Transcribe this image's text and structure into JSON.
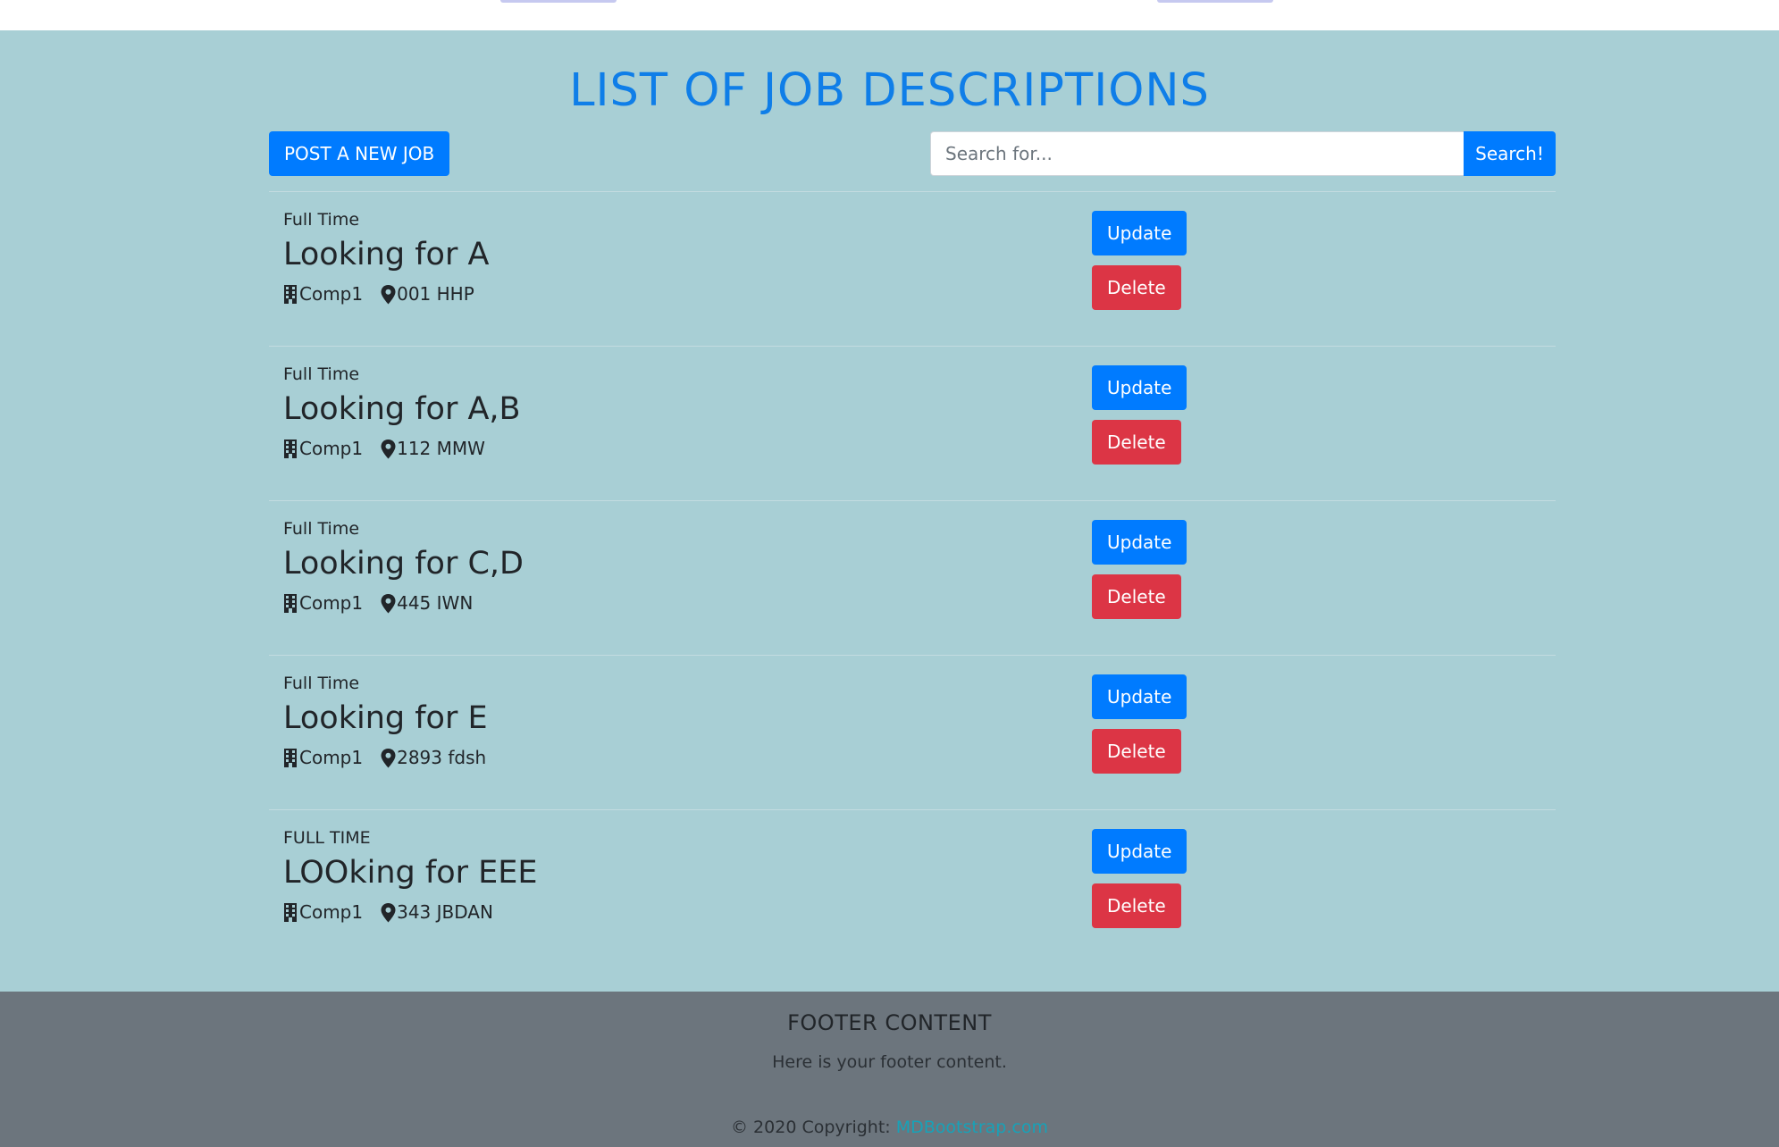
{
  "page": {
    "title": "LIST OF JOB DESCRIPTIONS"
  },
  "toolbar": {
    "post_button_label": "POST A NEW JOB",
    "search_placeholder": "Search for...",
    "search_value": "",
    "search_button_label": "Search!"
  },
  "jobs": [
    {
      "type": "Full Time",
      "title": "Looking for A",
      "company": "Comp1",
      "location": "001 HHP",
      "update_label": "Update",
      "delete_label": "Delete"
    },
    {
      "type": "Full Time",
      "title": "Looking for A,B",
      "company": "Comp1",
      "location": "112 MMW",
      "update_label": "Update",
      "delete_label": "Delete"
    },
    {
      "type": "Full Time",
      "title": "Looking for C,D",
      "company": "Comp1",
      "location": "445 IWN",
      "update_label": "Update",
      "delete_label": "Delete"
    },
    {
      "type": "Full Time",
      "title": "Looking for E",
      "company": "Comp1",
      "location": "2893 fdsh",
      "update_label": "Update",
      "delete_label": "Delete"
    },
    {
      "type": "FULL TIME",
      "title": "LOOking for EEE",
      "company": "Comp1",
      "location": "343 JBDAN",
      "update_label": "Update",
      "delete_label": "Delete"
    }
  ],
  "icons": {
    "company": "building-icon",
    "location": "map-marker-icon"
  },
  "footer": {
    "title": "FOOTER CONTENT",
    "text": "Here is your footer content.",
    "copyright_prefix": "© 2020 Copyright: ",
    "copyright_link": "MDBootstrap.com"
  },
  "colors": {
    "background": "#a8cfd5",
    "title": "#0f7ee8",
    "primary": "#007bff",
    "danger": "#dc3545",
    "footer": "#6c757d",
    "link": "#17a2b8"
  }
}
